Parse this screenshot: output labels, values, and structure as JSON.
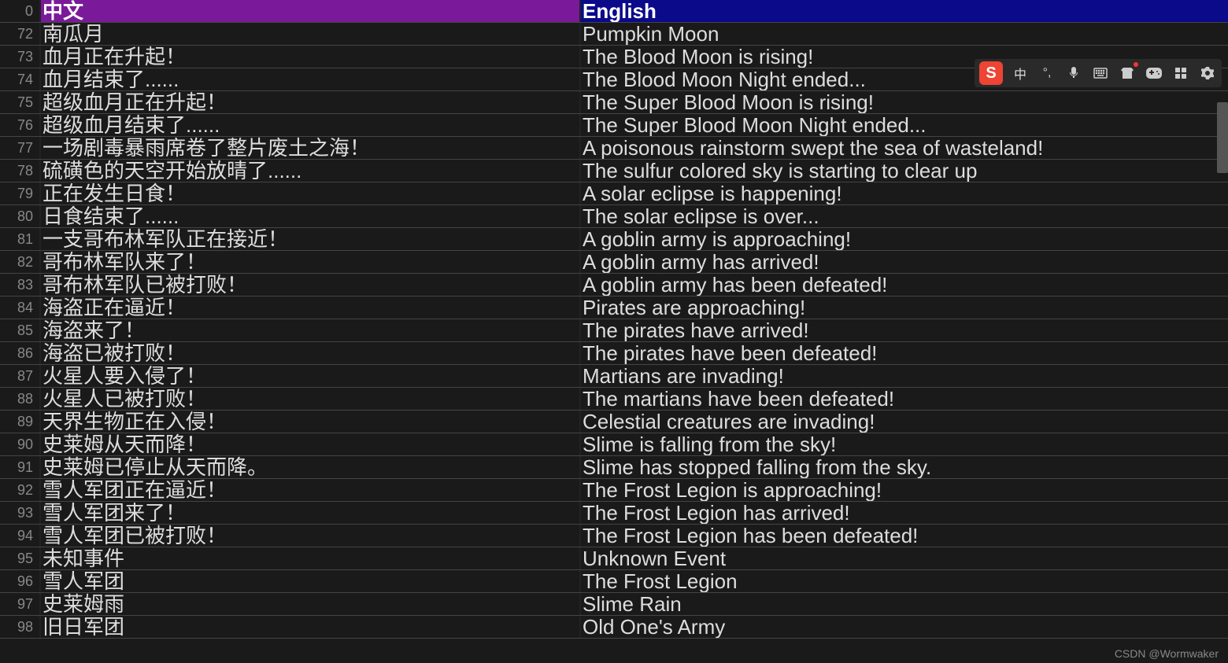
{
  "header": {
    "row_num": "0",
    "cn": "中文",
    "en": "English"
  },
  "rows": [
    {
      "num": "72",
      "cn": "南瓜月",
      "en": "Pumpkin Moon"
    },
    {
      "num": "73",
      "cn": "血月正在升起！",
      "en": "The Blood Moon is rising!"
    },
    {
      "num": "74",
      "cn": "血月结束了......",
      "en": "The Blood Moon Night ended..."
    },
    {
      "num": "75",
      "cn": "超级血月正在升起！",
      "en": "The Super Blood Moon is rising!"
    },
    {
      "num": "76",
      "cn": "超级血月结束了......",
      "en": "The Super Blood Moon Night ended..."
    },
    {
      "num": "77",
      "cn": "一场剧毒暴雨席卷了整片废土之海！",
      "en": "A poisonous rainstorm swept the sea of wasteland!"
    },
    {
      "num": "78",
      "cn": "硫磺色的天空开始放晴了......",
      "en": "The sulfur colored sky is starting to clear up"
    },
    {
      "num": "79",
      "cn": "正在发生日食！",
      "en": "A solar eclipse is happening!"
    },
    {
      "num": "80",
      "cn": "日食结束了......",
      "en": "The solar eclipse is over..."
    },
    {
      "num": "81",
      "cn": "一支哥布林军队正在接近！",
      "en": "A goblin army is approaching!"
    },
    {
      "num": "82",
      "cn": "哥布林军队来了！",
      "en": "A goblin army has arrived!"
    },
    {
      "num": "83",
      "cn": "哥布林军队已被打败！",
      "en": "A goblin army has been defeated!"
    },
    {
      "num": "84",
      "cn": "海盗正在逼近！",
      "en": "Pirates are approaching!"
    },
    {
      "num": "85",
      "cn": "海盗来了！",
      "en": "The pirates have arrived!"
    },
    {
      "num": "86",
      "cn": "海盗已被打败！",
      "en": "The pirates have been defeated!"
    },
    {
      "num": "87",
      "cn": "火星人要入侵了！",
      "en": "Martians are invading!"
    },
    {
      "num": "88",
      "cn": "火星人已被打败！",
      "en": "The martians have been defeated!"
    },
    {
      "num": "89",
      "cn": "天界生物正在入侵！",
      "en": "Celestial creatures are invading!"
    },
    {
      "num": "90",
      "cn": "史莱姆从天而降！",
      "en": "Slime is falling from the sky!"
    },
    {
      "num": "91",
      "cn": "史莱姆已停止从天而降。",
      "en": "Slime has stopped falling from the sky."
    },
    {
      "num": "92",
      "cn": "雪人军团正在逼近！",
      "en": "The Frost Legion is approaching!"
    },
    {
      "num": "93",
      "cn": "雪人军团来了！",
      "en": "The Frost Legion has arrived!"
    },
    {
      "num": "94",
      "cn": "雪人军团已被打败！",
      "en": "The Frost Legion has been defeated!"
    },
    {
      "num": "95",
      "cn": "未知事件",
      "en": "Unknown Event"
    },
    {
      "num": "96",
      "cn": "雪人军团",
      "en": "The Frost Legion"
    },
    {
      "num": "97",
      "cn": "史莱姆雨",
      "en": "Slime Rain"
    },
    {
      "num": "98",
      "cn": "旧日军团",
      "en": "Old One's Army"
    }
  ],
  "toolbar": {
    "ime_logo": "S",
    "lang_indicator": "中"
  },
  "watermark": "CSDN @Wormwaker"
}
